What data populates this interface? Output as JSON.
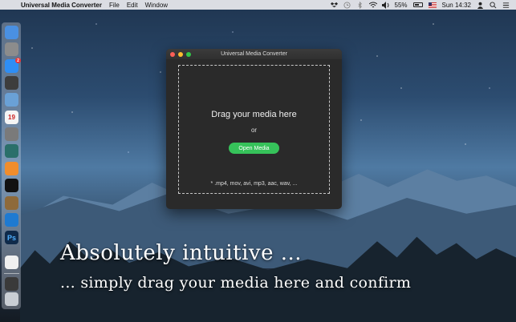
{
  "menubar": {
    "app_name": "Universal Media Converter",
    "menus": [
      "File",
      "Edit",
      "Window"
    ],
    "battery_percent": "55%",
    "clock": "Sun 14:32"
  },
  "dock": {
    "items": [
      {
        "name": "finder",
        "color": "#4a90e2"
      },
      {
        "name": "launchpad",
        "color": "#8c8c8c"
      },
      {
        "name": "app-store",
        "color": "#2e8ef5",
        "badge": "2"
      },
      {
        "name": "mission-control",
        "color": "#3d3d3d"
      },
      {
        "name": "preview",
        "color": "#6aa1d6"
      },
      {
        "name": "calendar",
        "color": "#f5f5f5",
        "text": "19"
      },
      {
        "name": "system-preferences",
        "color": "#7a7a7a"
      },
      {
        "name": "sequential",
        "color": "#2a6f6a"
      },
      {
        "name": "ibooks",
        "color": "#f08d2c"
      },
      {
        "name": "terminal",
        "color": "#111111"
      },
      {
        "name": "pixelmator",
        "color": "#8e6a3a"
      },
      {
        "name": "quicktime",
        "color": "#1e7ad1"
      },
      {
        "name": "photoshop",
        "color": "#0f2a4a",
        "text": "Ps"
      },
      {
        "name": "documents-folder",
        "color": "#f0f0f0"
      },
      {
        "name": "downloads-folder",
        "color": "#3a3a3a"
      },
      {
        "name": "trash",
        "color": "#c9ced4"
      }
    ]
  },
  "window": {
    "title": "Universal Media Converter",
    "drop_title": "Drag your media here",
    "or_text": "or",
    "open_button": "Open Media",
    "formats": "* .mp4, mov, avi, mp3, aac, wav, ..."
  },
  "captions": {
    "line1": "Absolutely intuitive ...",
    "line2": "... simply drag your media here and confirm"
  },
  "colors": {
    "accent_green": "#36c25a",
    "window_bg": "#2a2a2a",
    "close": "#fc5f57",
    "minimize": "#fdbc2e",
    "maximize": "#33c748"
  }
}
